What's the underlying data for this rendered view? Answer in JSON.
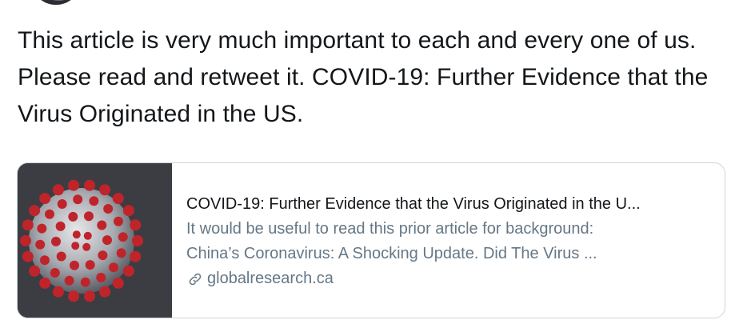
{
  "tweet": {
    "text": "This article is very much important to each and every one of us. Please read and retweet it. COVID-19: Further Evidence that the Virus Originated in the US."
  },
  "card": {
    "title": "COVID-19: Further Evidence that the Virus Originated in the U...",
    "description_line1": "It would be useful to read this prior article for background:",
    "description_line2": "China’s Coronavirus: A Shocking Update. Did The Virus ...",
    "domain": "globalresearch.ca",
    "image_icon": "coronavirus-illustration",
    "domain_icon": "link-icon"
  },
  "colors": {
    "text_primary": "#14171a",
    "text_secondary": "#657786",
    "card_border": "#ccd6dd",
    "virus_red": "#c0242b"
  }
}
